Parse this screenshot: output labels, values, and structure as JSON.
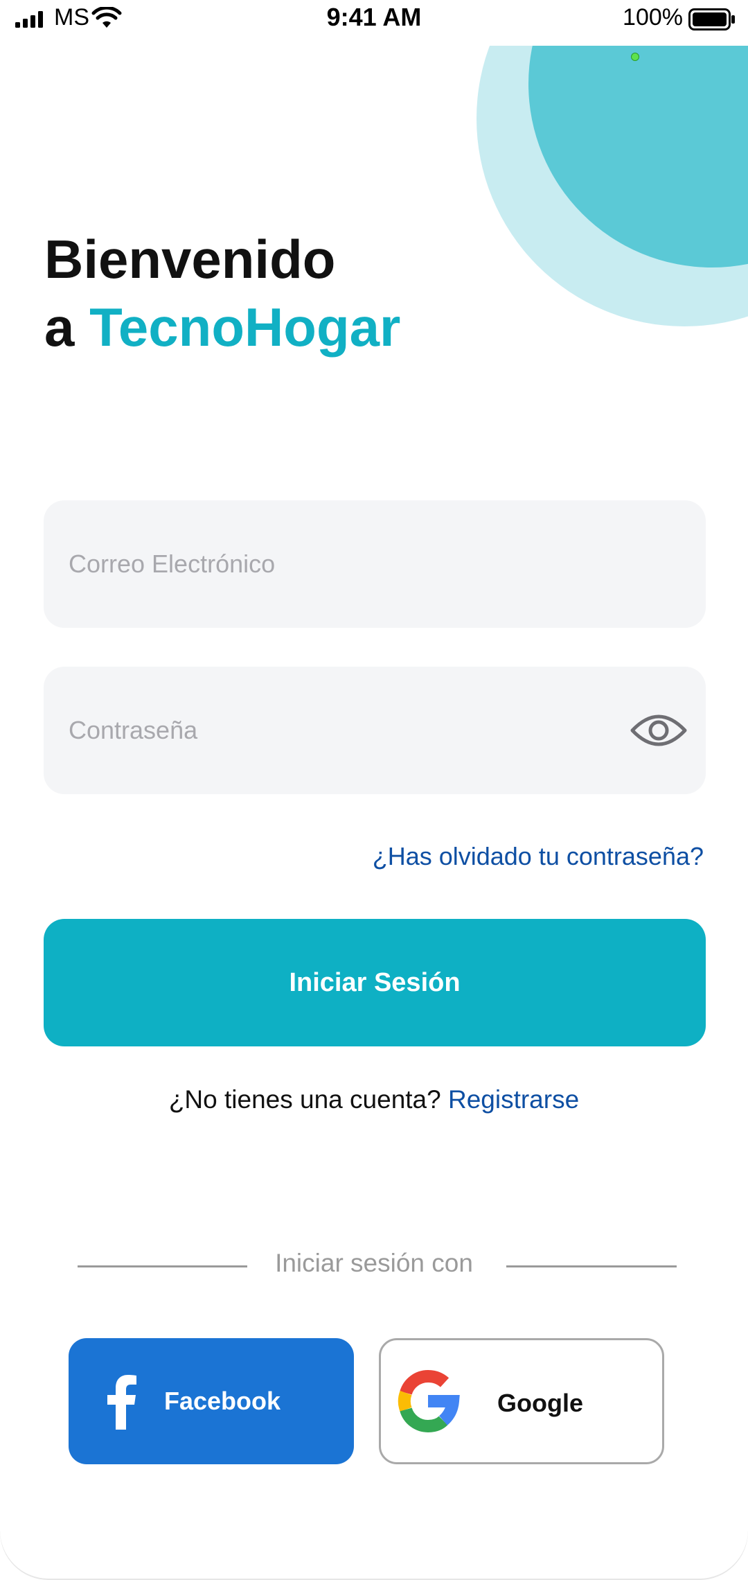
{
  "status_bar": {
    "carrier": "MS",
    "time": "9:41 AM",
    "battery_percent": "100%",
    "icons": [
      "signal-icon",
      "wifi-icon",
      "battery-icon"
    ]
  },
  "header": {
    "title_line1": "Bienvenido",
    "title_line2_prefix": "a ",
    "brand": "TecnoHogar"
  },
  "form": {
    "email_placeholder": "Correo Electrónico",
    "email_value": "",
    "password_placeholder": "Contraseña",
    "password_value": "",
    "password_toggle_icon": "eye-icon",
    "forgot_link": "¿Has olvidado tu contraseña?",
    "login_button": "Iniciar Sesión"
  },
  "register": {
    "prompt": "¿No tienes una cuenta?",
    "link": "Registrarse"
  },
  "social": {
    "divider_label": "Iniciar sesión con",
    "facebook_label": "Facebook",
    "google_label": "Google"
  },
  "colors": {
    "brand_teal": "#0eb0c4",
    "circle_light": "#c8ecf1",
    "circle_dark": "#5bc9d6",
    "link_blue": "#0e4fa3",
    "facebook_blue": "#1b74d4",
    "field_bg": "#f4f5f7"
  }
}
